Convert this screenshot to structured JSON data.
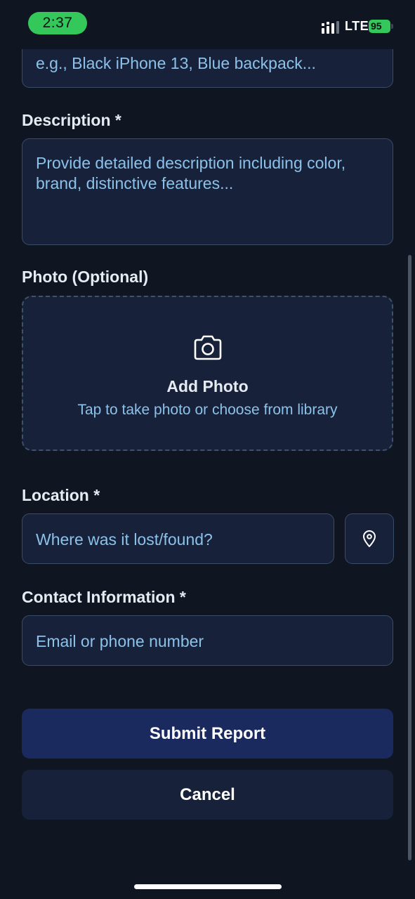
{
  "status_bar": {
    "time": "2:37",
    "network": "LTE",
    "battery": "95"
  },
  "form": {
    "item_name": {
      "placeholder": "e.g., Black iPhone 13, Blue backpack..."
    },
    "description": {
      "label": "Description *",
      "placeholder_line1": "Provide detailed description including color,",
      "placeholder_line2": "brand, distinctive features..."
    },
    "photo": {
      "label": "Photo (Optional)",
      "title": "Add Photo",
      "subtitle": "Tap to take photo or choose from library",
      "icon": "camera-icon"
    },
    "location": {
      "label": "Location *",
      "placeholder": "Where was it lost/found?",
      "icon": "map-pin-icon"
    },
    "contact": {
      "label": "Contact Information *",
      "placeholder": "Email or phone number"
    }
  },
  "actions": {
    "submit_label": "Submit Report",
    "cancel_label": "Cancel"
  },
  "colors": {
    "background": "#0f1521",
    "field": "#17223a",
    "placeholder": "#8cc1ea",
    "submit": "#1a2a5e",
    "status_green": "#34c759"
  }
}
